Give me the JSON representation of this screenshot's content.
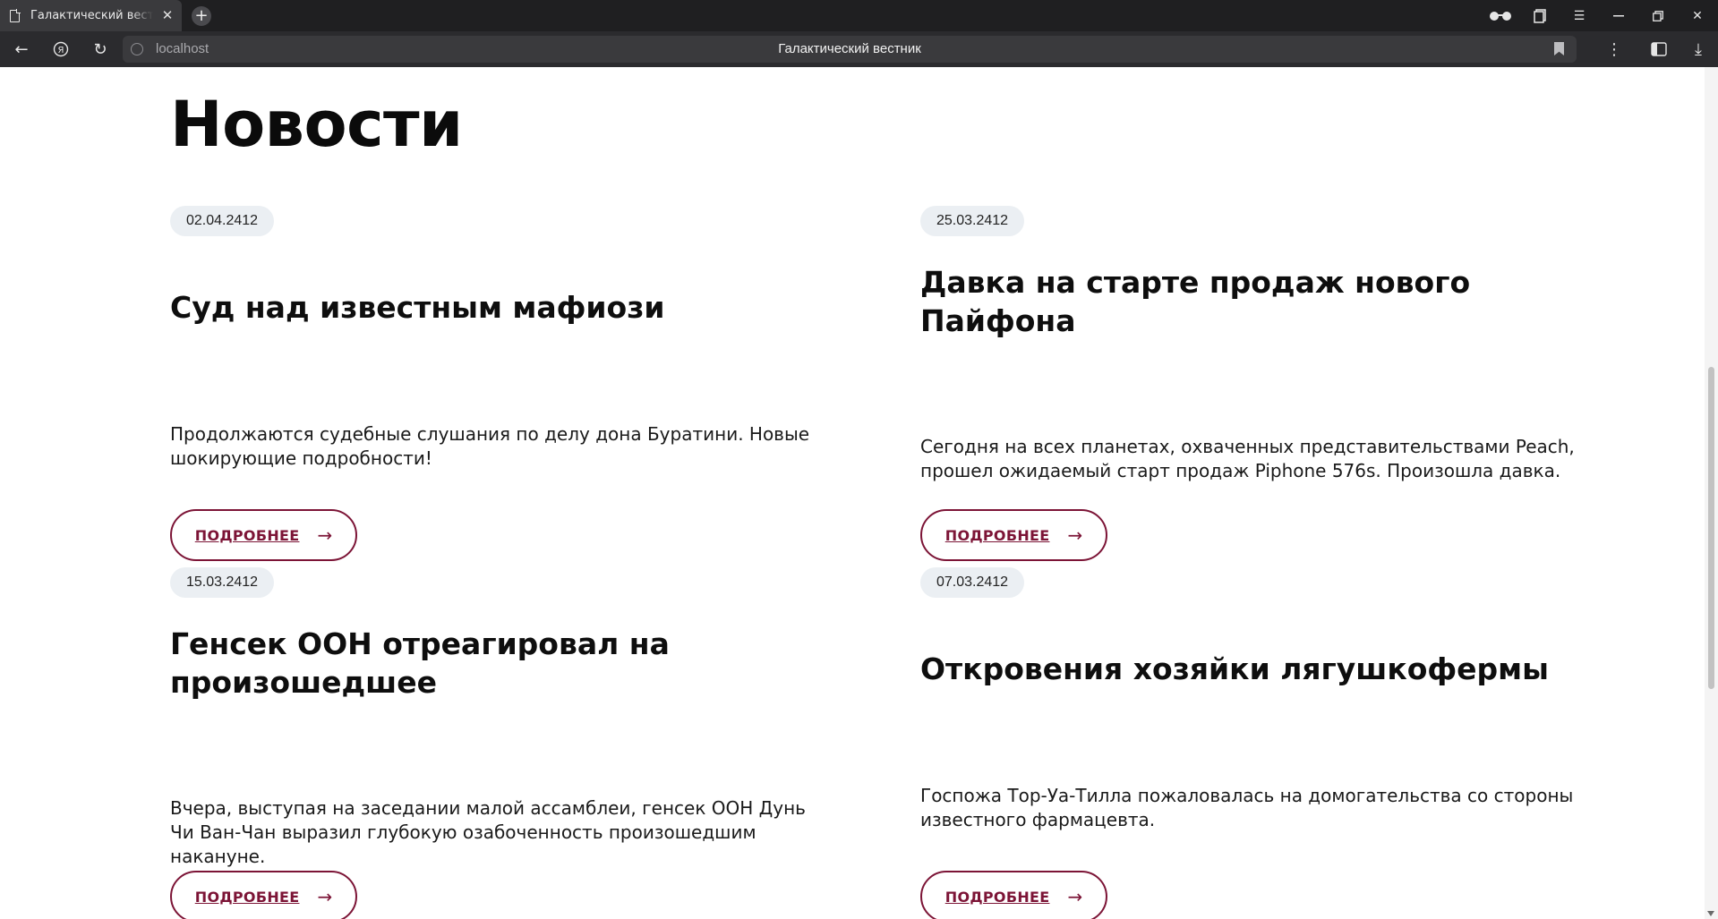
{
  "browser": {
    "tab_title": "Галактический вестник",
    "new_tab_symbol": "+",
    "tab_close_symbol": "✕",
    "url": "localhost",
    "page_title": "Галактический вестник"
  },
  "page": {
    "heading": "Новости",
    "news": [
      {
        "date": "02.04.2412",
        "title": "Суд над известным мафиози",
        "description": "Продолжаются судебные слушания по делу дона Буратини. Новые шокирующие подробности!",
        "button_label": "ПОДРОБНЕЕ"
      },
      {
        "date": "25.03.2412",
        "title": "Давка на старте продаж нового Пайфона",
        "description": "Сегодня на всех планетах, охваченных представительствами Peach, прошел ожидаемый старт продаж Piphone 576s. Произошла давка.",
        "button_label": "ПОДРОБНЕЕ"
      },
      {
        "date": "15.03.2412",
        "title": "Генсек ООН отреагировал на произошедшее",
        "description": "Вчера, выступая на заседании малой ассамблеи, генсек ООН Дунь Чи Ван-Чан выразил глубокую озабоченность произошедшим накануне.",
        "button_label": "ПОДРОБНЕЕ"
      },
      {
        "date": "07.03.2412",
        "title": "Откровения хозяйки лягушкофермы",
        "description": "Госпожа Тор-Уа-Тилла пожаловалась на домогательства со стороны известного фармацевта.",
        "button_label": "ПОДРОБНЕЕ"
      }
    ]
  },
  "icons": {
    "arrow": "→",
    "back": "←",
    "reload": "↻",
    "menu": "☰",
    "minimize": "—",
    "restore": "❐",
    "close": "✕",
    "more_vert": "⋮",
    "download": "⤓"
  },
  "colors": {
    "accent": "#7c1436",
    "date_badge_bg": "#ebeff3",
    "chrome_bg": "#2b2b2e",
    "tabstrip_bg": "#1f1f21"
  }
}
